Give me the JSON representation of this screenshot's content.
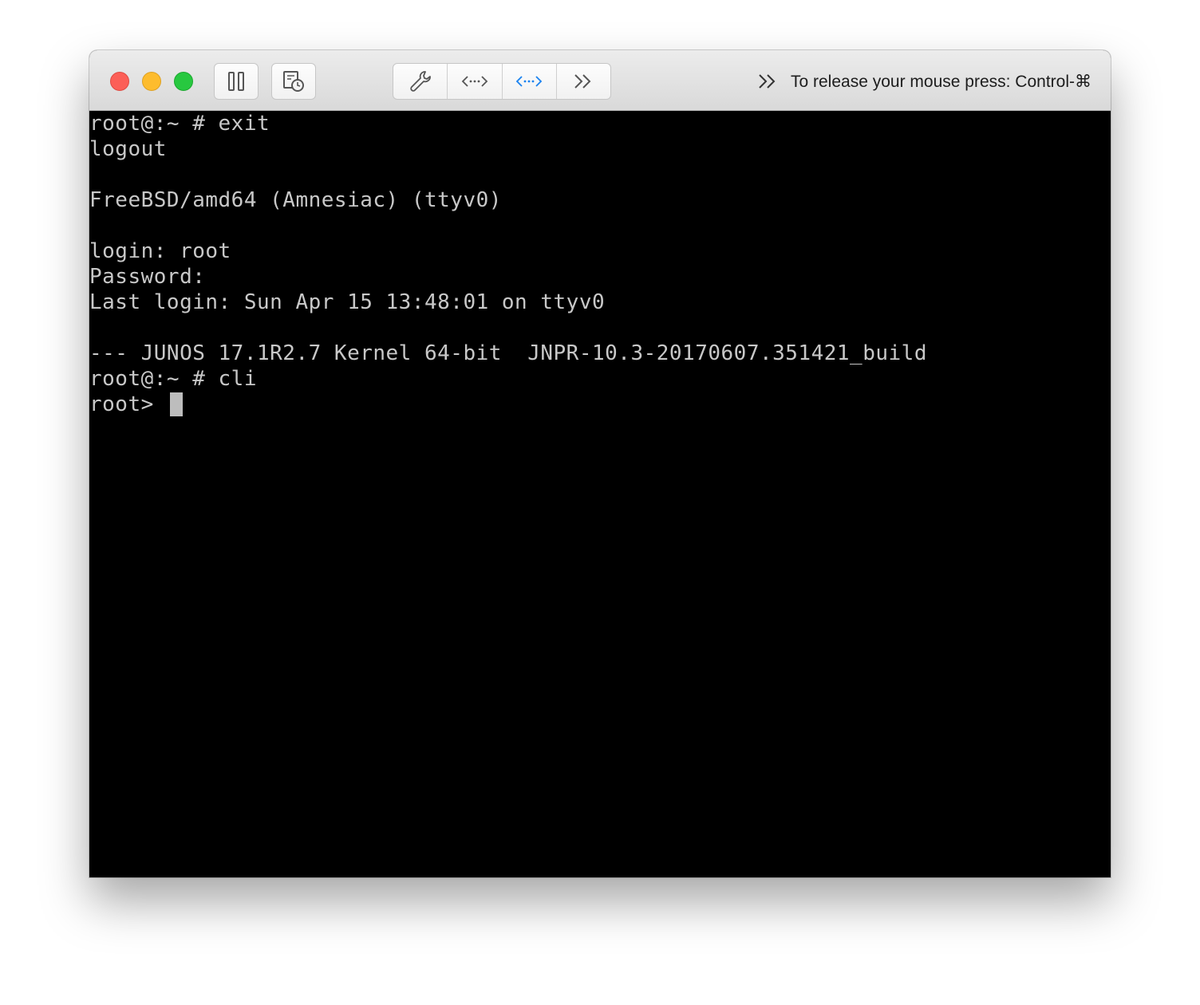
{
  "toolbar": {
    "release_hint": "To release your mouse press: Control-⌘"
  },
  "terminal": {
    "lines": [
      "root@:~ # exit",
      "logout",
      "",
      "FreeBSD/amd64 (Amnesiac) (ttyv0)",
      "",
      "login: root",
      "Password:",
      "Last login: Sun Apr 15 13:48:01 on ttyv0",
      "",
      "--- JUNOS 17.1R2.7 Kernel 64-bit  JNPR-10.3-20170607.351421_build",
      "root@:~ # cli"
    ],
    "prompt": "root> "
  },
  "colors": {
    "close": "#fc5f57",
    "minimize": "#fdbc2e",
    "maximize": "#28c840",
    "terminal_bg": "#000000",
    "terminal_fg": "#c8c8c8",
    "accent_blue": "#1a82f0"
  }
}
